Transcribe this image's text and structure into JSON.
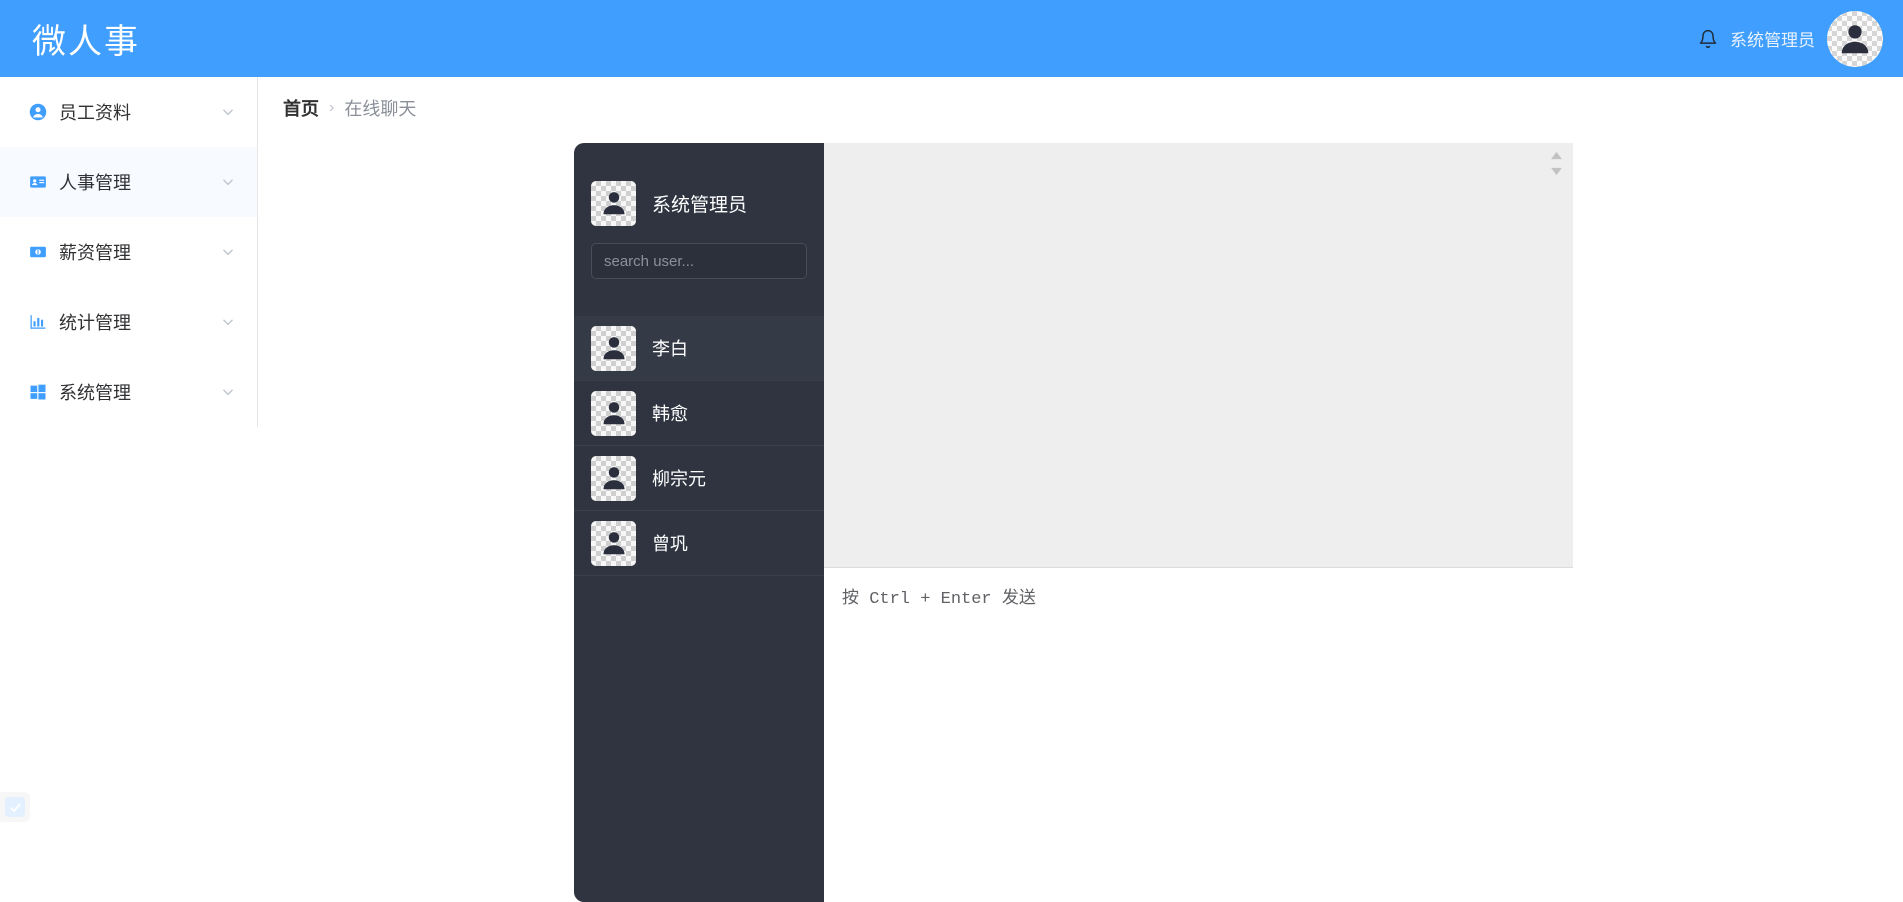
{
  "header": {
    "title": "微人事",
    "bell_icon": "bell-icon",
    "user_name": "系统管理员",
    "avatar_icon": "user-avatar-icon",
    "background_color": "#409EFF"
  },
  "sidebar": {
    "items": [
      {
        "label": "员工资料",
        "icon": "user-circle-icon",
        "chevron": "chevron-down-icon",
        "active": false
      },
      {
        "label": "人事管理",
        "icon": "id-card-icon",
        "chevron": "chevron-down-icon",
        "active": true
      },
      {
        "label": "薪资管理",
        "icon": "money-icon",
        "chevron": "chevron-down-icon",
        "active": false
      },
      {
        "label": "统计管理",
        "icon": "bar-chart-icon",
        "chevron": "chevron-down-icon",
        "active": false
      },
      {
        "label": "系统管理",
        "icon": "windows-icon",
        "chevron": "chevron-down-icon",
        "active": false
      }
    ]
  },
  "breadcrumb": {
    "home": "首页",
    "separator": "›",
    "current": "在线聊天"
  },
  "chat": {
    "current_user": {
      "name": "系统管理员",
      "avatar_icon": "user-avatar-icon"
    },
    "search": {
      "placeholder": "search user...",
      "value": ""
    },
    "users": [
      {
        "name": "李白",
        "avatar_icon": "user-avatar-icon",
        "active": true
      },
      {
        "name": "韩愈",
        "avatar_icon": "user-avatar-icon",
        "active": false
      },
      {
        "name": "柳宗元",
        "avatar_icon": "user-avatar-icon",
        "active": false
      },
      {
        "name": "曾巩",
        "avatar_icon": "user-avatar-icon",
        "active": false
      }
    ],
    "messages": [],
    "input": {
      "value": "",
      "send_hint": "按 Ctrl + Enter 发送"
    },
    "panel_color": "#2F3440",
    "message_area_color": "#EEEEEE"
  },
  "corner_widget": {
    "icon": "check-icon",
    "color": "#E3F0FF"
  }
}
